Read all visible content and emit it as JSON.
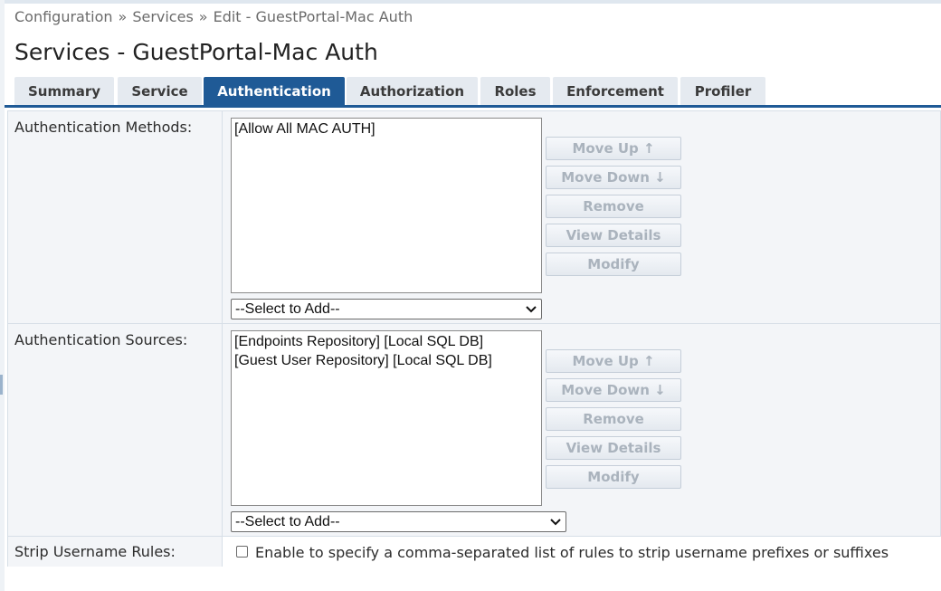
{
  "breadcrumb": {
    "items": [
      "Configuration",
      "Services",
      "Edit - GuestPortal-Mac Auth"
    ],
    "separator": "»"
  },
  "page_title": "Services - GuestPortal-Mac Auth",
  "tabs": [
    {
      "label": "Summary",
      "active": false
    },
    {
      "label": "Service",
      "active": false
    },
    {
      "label": "Authentication",
      "active": true
    },
    {
      "label": "Authorization",
      "active": false
    },
    {
      "label": "Roles",
      "active": false
    },
    {
      "label": "Enforcement",
      "active": false
    },
    {
      "label": "Profiler",
      "active": false
    }
  ],
  "auth_methods": {
    "label": "Authentication Methods:",
    "items": [
      "[Allow All MAC AUTH]"
    ],
    "select_placeholder": "--Select to Add--",
    "buttons": {
      "move_up": "Move Up ↑",
      "move_down": "Move Down ↓",
      "remove": "Remove",
      "view_details": "View Details",
      "modify": "Modify"
    }
  },
  "auth_sources": {
    "label": "Authentication Sources:",
    "items": [
      "[Endpoints Repository] [Local SQL DB]",
      "[Guest User Repository] [Local SQL DB]"
    ],
    "select_placeholder": "--Select to Add--",
    "buttons": {
      "move_up": "Move Up ↑",
      "move_down": "Move Down ↓",
      "remove": "Remove",
      "view_details": "View Details",
      "modify": "Modify"
    }
  },
  "strip_username": {
    "label": "Strip Username Rules:",
    "checkbox_label": "Enable to specify a comma-separated list of rules to strip username prefixes or suffixes",
    "checked": false
  },
  "colors": {
    "accent": "#1f5a96",
    "tab_inactive": "#e5eaf0",
    "disabled_text": "#aab3bd"
  }
}
